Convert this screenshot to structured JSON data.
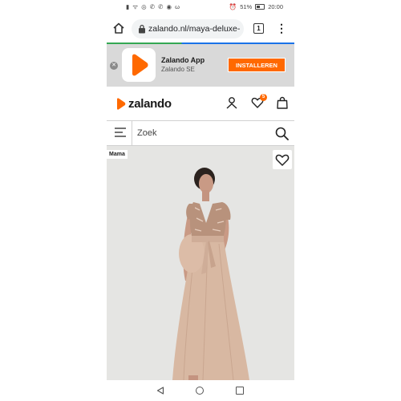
{
  "status_bar": {
    "left_icons": "▮ ᯤ ◎ ✆ ✆ ◉ ω",
    "battery_percent": "51%",
    "time": "20:00"
  },
  "browser": {
    "url": "zalando.nl/maya-deluxe-",
    "tab_count": "1"
  },
  "app_banner": {
    "title": "Zalando App",
    "subtitle": "Zalando SE",
    "install_label": "INSTALLEREN",
    "close_glyph": "✕"
  },
  "header": {
    "brand": "zalando",
    "wishlist_count": "5"
  },
  "search": {
    "placeholder": "Zoek"
  },
  "product": {
    "badge": "Mama"
  },
  "colors": {
    "brand_orange": "#ff6900",
    "banner_bg": "#d9d9d9",
    "dress": "#d8b8a2"
  },
  "icons": [
    "home-icon",
    "lock-icon",
    "tabs-icon",
    "kebab-menu-icon",
    "zalando-play-icon",
    "user-icon",
    "heart-icon",
    "bag-icon",
    "hamburger-menu-icon",
    "search-icon",
    "back-icon",
    "home-circle-icon",
    "recents-icon"
  ]
}
